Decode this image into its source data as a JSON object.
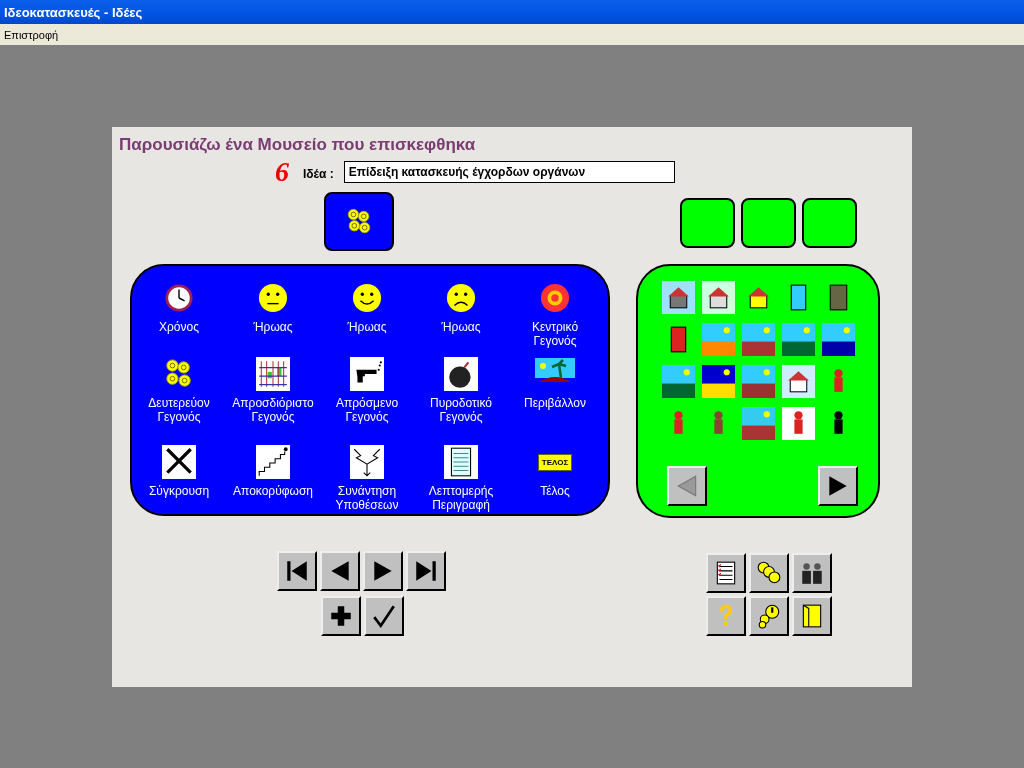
{
  "window": {
    "title": "Ιδεοκατασκευές - Ιδέες"
  },
  "menu": [
    "Επιστροφή"
  ],
  "heading": "Παρουσιάζω ένα Μουσείο που επισκεφθηκα",
  "idea": {
    "number": "6",
    "label": "Ιδέα :",
    "value": "Επίδειξη κατασκευής έγχορδων οργάνων"
  },
  "selected_element": {
    "kind": "coins"
  },
  "elements": [
    {
      "kind": "clock",
      "label": "Χρόνος"
    },
    {
      "kind": "neutral-face",
      "label": "Ήρωας"
    },
    {
      "kind": "smile-face",
      "label": "Ήρωας"
    },
    {
      "kind": "sad-face",
      "label": "Ήρωας"
    },
    {
      "kind": "target",
      "label": "Κεντρικό Γεγονός"
    },
    {
      "kind": "coins",
      "label": "Δευτερεύον Γεγονός"
    },
    {
      "kind": "grid",
      "label": "Απροσδιόριστο Γεγονός"
    },
    {
      "kind": "pistol",
      "label": "Απρόσμενο Γεγονός"
    },
    {
      "kind": "bomb",
      "label": "Πυροδοτικό Γεγονός"
    },
    {
      "kind": "island",
      "label": "Περιβάλλον"
    },
    {
      "kind": "swords",
      "label": "Σύγκρουση"
    },
    {
      "kind": "stairs",
      "label": "Αποκορύφωση"
    },
    {
      "kind": "arrows",
      "label": "Συνάντηση Υποθέσεων"
    },
    {
      "kind": "notepad",
      "label": "Λεπτομερής Περιγραφή"
    },
    {
      "kind": "sign",
      "label": "Τέλος",
      "sign_text": "ΤΕΛΟΣ"
    }
  ]
}
